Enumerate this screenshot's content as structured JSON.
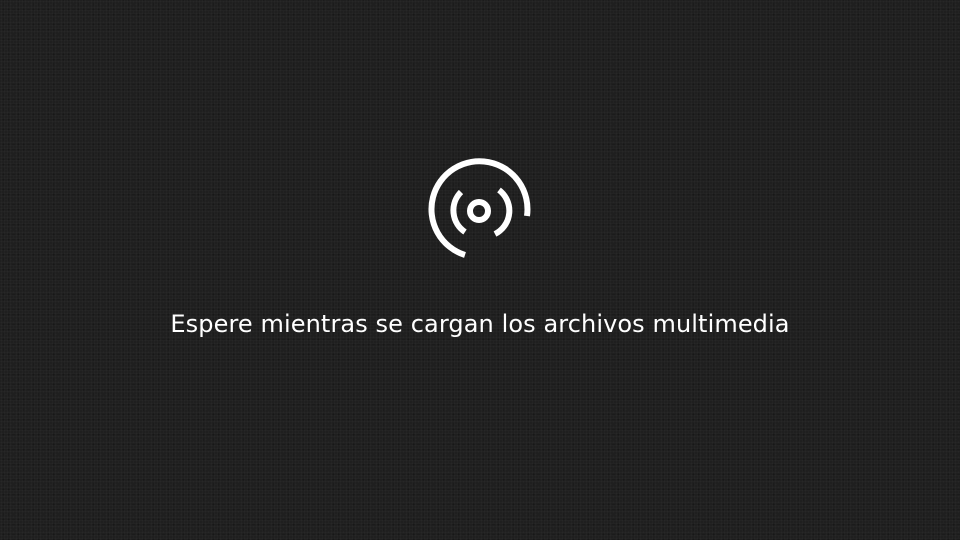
{
  "loader": {
    "icon": "media-loading-spinner-icon",
    "message": "Espere mientras se cargan los archivos multimedia"
  },
  "colors": {
    "background": "#1f1f1f",
    "foreground": "#ffffff"
  }
}
